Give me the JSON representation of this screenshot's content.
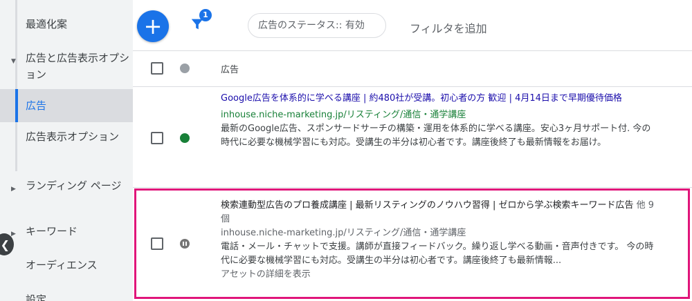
{
  "sidebar": {
    "items": [
      {
        "label": "最適化案"
      },
      {
        "label": "広告と広告表示オプション"
      },
      {
        "label": "広告"
      },
      {
        "label": "広告表示オプション"
      },
      {
        "label": "ランディング ページ"
      },
      {
        "label": "キーワード"
      },
      {
        "label": "オーディエンス"
      },
      {
        "label": "設定"
      }
    ]
  },
  "toolbar": {
    "fab_label": "+",
    "filter_count": "1",
    "status_chip": "広告のステータス:: 有効",
    "add_filter": "フィルタを追加"
  },
  "table": {
    "column_ad": "広告",
    "rows": [
      {
        "headline": "Google広告を体系的に学べる講座 | 約480社が受講。初心者の方 歓迎 | 4月14日まで早期優待価格",
        "url": "inhouse.niche-marketing.jp/リスティング/通信・通学講座",
        "description": "最新のGoogle広告、スポンサードサーチの構築・運用を体系的に学べる講座。安心3ヶ月サポート付. 今の時代に必要な機械学習にも対応。受講生の半分は初心者です。講座後終了も最新情報をお届け。",
        "status": "enabled"
      },
      {
        "headline": "検索連動型広告のプロ養成講座 | 最新リスティングのノウハウ習得 | ゼロから学ぶ検索キーワード広告",
        "more": "他 9 個",
        "url": "inhouse.niche-marketing.jp/リスティング/通信・通学講座",
        "description": "電話・メール・チャットで支援。講師が直接フィードバック。繰り返し学べる動画・音声付きです。 今の時代に必要な機械学習にも対応。受講生の半分は初心者です。講座後終了も最新情報...",
        "details_link": "アセットの詳細を表示",
        "status": "paused"
      }
    ]
  },
  "colors": {
    "primary": "#1a73e8",
    "enabled": "#188038",
    "highlight": "#e0157a"
  }
}
